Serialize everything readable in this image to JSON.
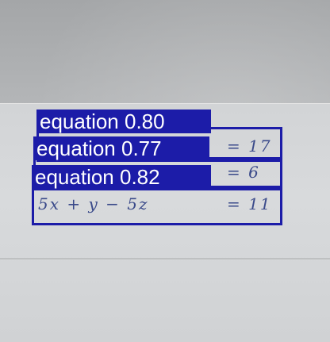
{
  "photo": {
    "lines": [
      {
        "right": "= 17"
      },
      {
        "right": "= 6"
      },
      {
        "left": "5x + y − 5z",
        "right": "= 11"
      }
    ]
  },
  "detections": [
    {
      "label": "equation 0.80"
    },
    {
      "label": "equation 0.77"
    },
    {
      "label": "equation 0.82"
    }
  ],
  "colors": {
    "box": "#1c1ca8",
    "label_text": "#ffffff"
  }
}
